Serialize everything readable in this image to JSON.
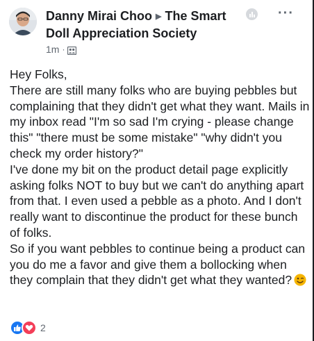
{
  "post": {
    "author": "Danny Mirai Choo",
    "group": "The Smart Doll Appreciation Society",
    "timestamp": "1m",
    "separator": "·",
    "audience_icon": "group-icon",
    "more_label": "···",
    "body": "Hey Folks,\nThere are still many folks who are buying pebbles but complaining that they didn't get what they want. Mails in my inbox read \"I'm so sad I'm crying - please change this\" \"there must be some mistake\" \"why didn't you check my order history?\"\nI've done my bit on the product detail page explicitly asking folks NOT to buy but we can't do anything apart from that. I even used a pebble as a photo. And I don't really want to discontinue the product for these bunch of folks.\nSo if you want pebbles to continue being a product can you do me a favor and give them a bollocking when they complain that they didn't get what they wanted?",
    "emoji": "winking-face-emoji"
  },
  "reactions": {
    "types": [
      "like-icon",
      "love-icon"
    ],
    "count": "2"
  },
  "colors": {
    "like": "#1877f2",
    "love": "#f33e58",
    "text": "#1c1e21",
    "secondary": "#606770",
    "emoji": "#f5b400"
  }
}
